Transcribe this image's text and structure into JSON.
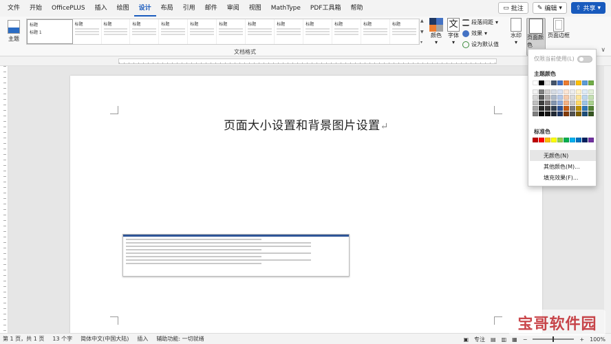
{
  "menubar": {
    "items": [
      "文件",
      "开始",
      "OfficePLUS",
      "插入",
      "绘图",
      "设计",
      "布局",
      "引用",
      "邮件",
      "审阅",
      "视图",
      "MathType",
      "PDF工具箱",
      "帮助"
    ],
    "active_index": 5,
    "comment_label": "批注",
    "edit_label": "编辑",
    "share_label": "共享"
  },
  "ribbon": {
    "theme_label": "主题",
    "style_titles": [
      "标题",
      "标题",
      "标题",
      "标题",
      "标题",
      "标题",
      "标题",
      "标题",
      "标题",
      "标题",
      "标题",
      "标题",
      "标题"
    ],
    "first_style_label": "标题 1",
    "group_label": "文档格式",
    "colors_label": "颜色",
    "fonts_label": "字体",
    "paragraph_spacing_label": "段落间距",
    "effects_label": "效果",
    "set_default_label": "设为默认值",
    "watermark_label": "水印",
    "page_color_label": "页面颜色",
    "page_borders_label": "页面边框"
  },
  "document": {
    "title": "页面大小设置和背景图片设置"
  },
  "page_color_menu": {
    "sync_label": "仅限当前使用(L)",
    "theme_colors_label": "主题颜色",
    "standard_colors_label": "标准色",
    "no_color_label": "无颜色(N)",
    "more_colors_label": "其他颜色(M)...",
    "fill_effects_label": "填充效果(F)...",
    "theme_top_row": [
      "#ffffff",
      "#000000",
      "#e7e6e6",
      "#44546a",
      "#4472c4",
      "#ed7d31",
      "#a5a5a5",
      "#ffc000",
      "#5b9bd5",
      "#70ad47"
    ],
    "theme_shades": [
      [
        "#f2f2f2",
        "#7f7f7f",
        "#d0cece",
        "#d6dce4",
        "#d9e2f3",
        "#fbe5d5",
        "#ededed",
        "#fff2cc",
        "#deebf6",
        "#e2efd9"
      ],
      [
        "#d8d8d8",
        "#595959",
        "#aeabab",
        "#adb9ca",
        "#b4c6e7",
        "#f7cbac",
        "#dbdbdb",
        "#fee599",
        "#bdd7ee",
        "#c5e0b3"
      ],
      [
        "#bfbfbf",
        "#3f3f3f",
        "#757070",
        "#8496b0",
        "#8eaadb",
        "#f4b183",
        "#c9c9c9",
        "#ffd965",
        "#9cc3e5",
        "#a8d08d"
      ],
      [
        "#a5a5a5",
        "#262626",
        "#3a3838",
        "#323f4f",
        "#2f5496",
        "#c55a11",
        "#7b7b7b",
        "#bf9000",
        "#2e75b5",
        "#538135"
      ],
      [
        "#7f7f7f",
        "#0c0c0c",
        "#171616",
        "#222a35",
        "#1f3864",
        "#833c0b",
        "#525252",
        "#7f6000",
        "#1e4e79",
        "#375623"
      ]
    ],
    "standard_colors": [
      "#c00000",
      "#ff0000",
      "#ffc000",
      "#ffff00",
      "#92d050",
      "#00b050",
      "#00b0f0",
      "#0070c0",
      "#002060",
      "#7030a0"
    ]
  },
  "statusbar": {
    "page": "第 1 页，共 1 页",
    "words": "13 个字",
    "language": "简体中文(中国大陆)",
    "insert_mode": "插入",
    "accessibility": "辅助功能: 一切就绪",
    "focus_label": "专注",
    "zoom": "100%"
  },
  "watermark": {
    "text": "宝哥软件园"
  }
}
